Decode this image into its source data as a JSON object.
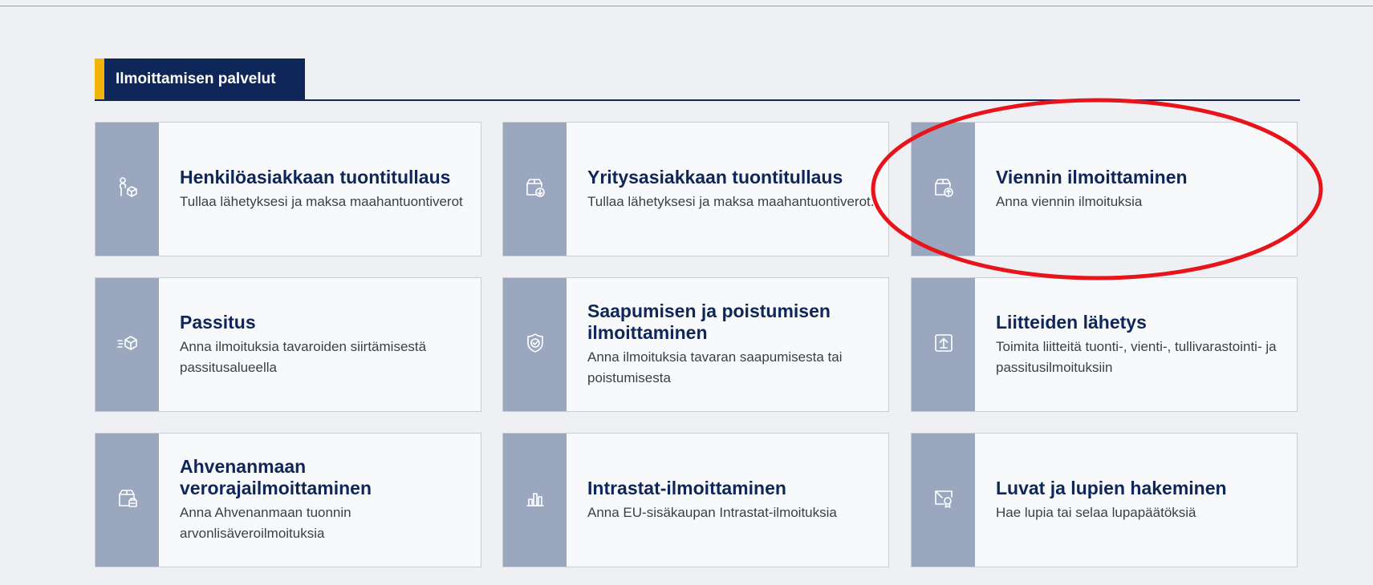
{
  "section": {
    "title": "Ilmoittamisen palvelut"
  },
  "cards": [
    {
      "title": "Henkilöasiakkaan tuontitullaus",
      "desc": "Tullaa lähetyksesi ja maksa maahantuontiverot",
      "icon": "person-package-icon"
    },
    {
      "title": "Yritysasiakkaan tuontitullaus",
      "desc": "Tullaa lähetyksesi ja maksa maahantuontiverot.",
      "icon": "package-import-icon"
    },
    {
      "title": "Viennin ilmoittaminen",
      "desc": "Anna viennin ilmoituksia",
      "icon": "package-export-icon"
    },
    {
      "title": "Passitus",
      "desc": "Anna ilmoituksia tavaroiden siirtämisestä passitusalueella",
      "icon": "moving-package-icon"
    },
    {
      "title": "Saapumisen ja poistumisen ilmoittaminen",
      "desc": "Anna ilmoituksia tavaran saapumisesta tai poistumisesta",
      "icon": "shield-check-icon"
    },
    {
      "title": "Liitteiden lähetys",
      "desc": "Toimita liitteitä tuonti-, vienti-, tullivarastointi- ja passitusilmoituksiin",
      "icon": "upload-box-icon"
    },
    {
      "title": "Ahvenanmaan verorajailmoittaminen",
      "desc": "Anna Ahvenanmaan tuonnin arvonlisäveroilmoituksia",
      "icon": "package-tax-icon"
    },
    {
      "title": "Intrastat-ilmoittaminen",
      "desc": "Anna EU-sisäkaupan Intrastat-ilmoituksia",
      "icon": "bar-chart-icon"
    },
    {
      "title": "Luvat ja lupien hakeminen",
      "desc": "Hae lupia tai selaa lupapäätöksiä",
      "icon": "certificate-icon"
    }
  ],
  "colors": {
    "navy": "#0f2658",
    "accent": "#f2b40a",
    "icon_panel": "#9ba7be",
    "highlight": "#e8141b"
  }
}
